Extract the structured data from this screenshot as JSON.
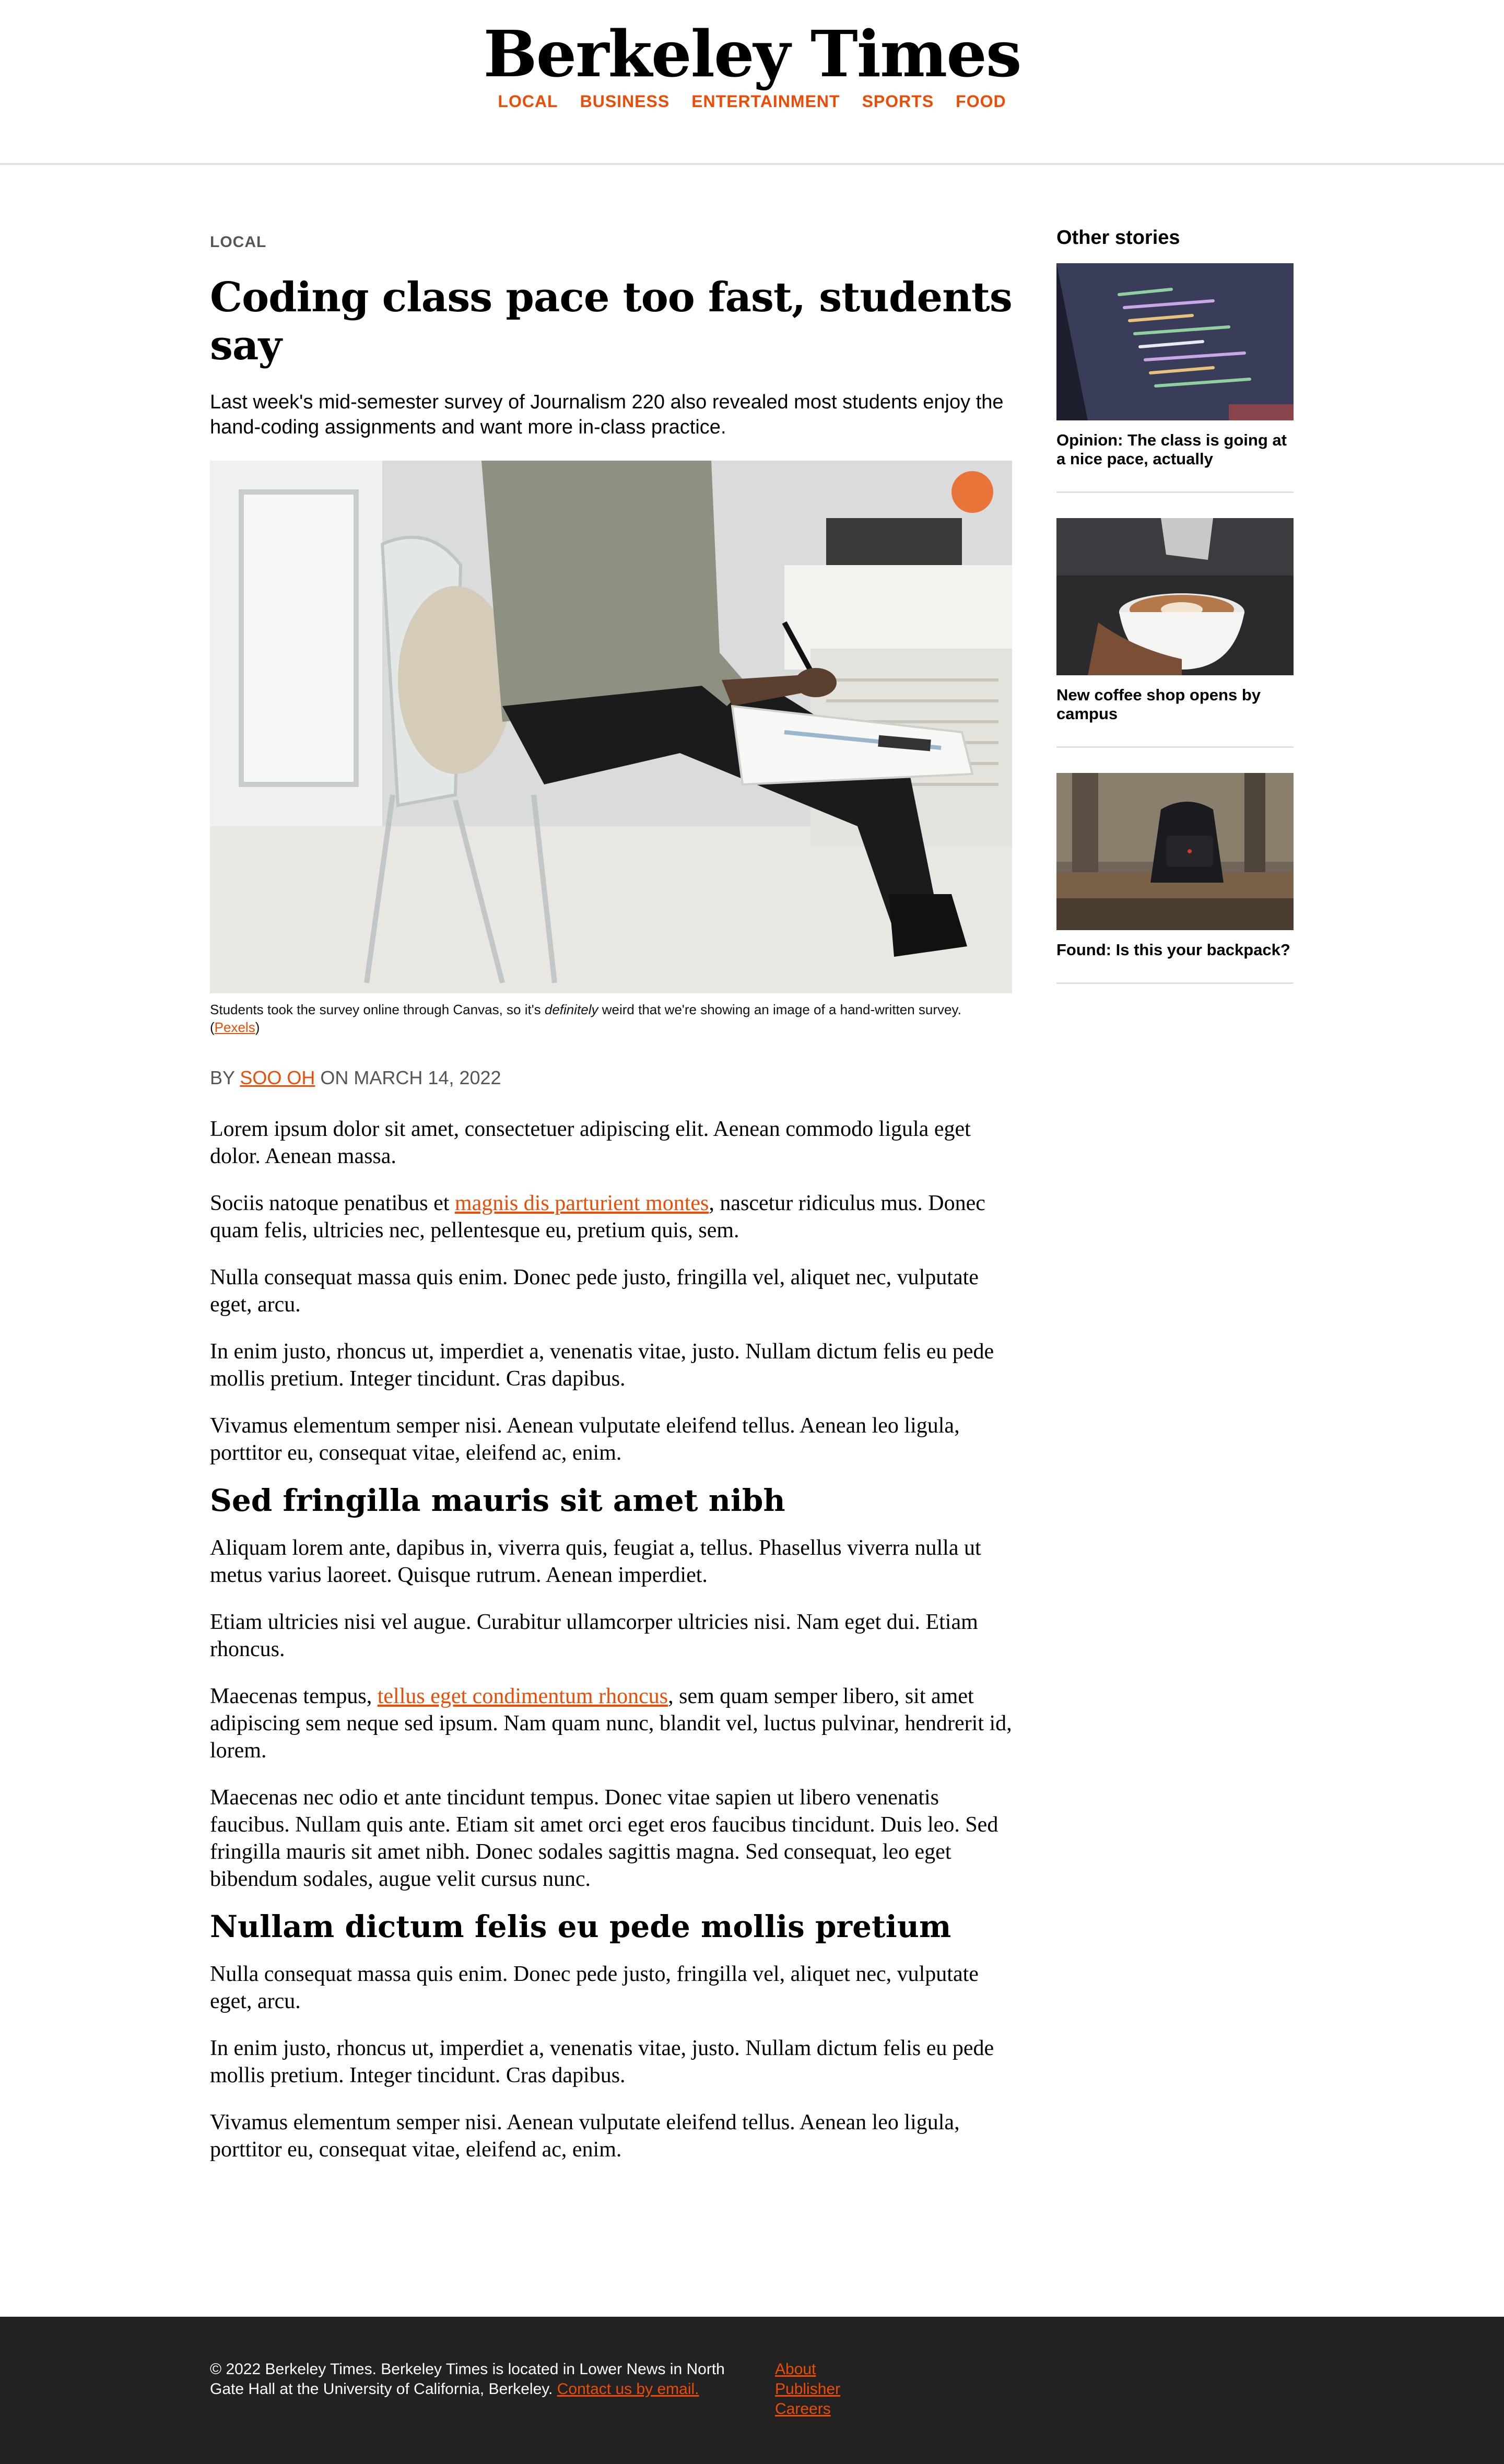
{
  "header": {
    "masthead": "Berkeley Times",
    "nav": [
      "LOCAL",
      "BUSINESS",
      "ENTERTAINMENT",
      "SPORTS",
      "FOOD"
    ]
  },
  "article": {
    "kicker": "LOCAL",
    "headline": "Coding class pace too fast, students say",
    "dek": "Last week's mid-semester survey of Journalism 220 also revealed most students enjoy the hand-coding assignments and want more in-class practice.",
    "caption": {
      "before": "Students took the survey online through Canvas, so it's ",
      "emphasis": "definitely",
      "after": " weird that we're showing an image of a hand-written survey. (",
      "link": "Pexels",
      "close": ")"
    },
    "byline": {
      "by": "BY ",
      "author": "SOO OH",
      "date": " ON MARCH 14, 2022"
    },
    "p1": "Lorem ipsum dolor sit amet, consectetuer adipiscing elit. Aenean commodo ligula eget dolor. Aenean massa.",
    "p2": {
      "before": "Sociis natoque penatibus et ",
      "link": "magnis dis parturient montes",
      "after": ", nascetur ridiculus mus. Donec quam felis, ultricies nec, pellentesque eu, pretium quis, sem."
    },
    "p3": "Nulla consequat massa quis enim. Donec pede justo, fringilla vel, aliquet nec, vulputate eget, arcu.",
    "p4": "In enim justo, rhoncus ut, imperdiet a, venenatis vitae, justo. Nullam dictum felis eu pede mollis pretium. Integer tincidunt. Cras dapibus.",
    "p5": "Vivamus elementum semper nisi. Aenean vulputate eleifend tellus. Aenean leo ligula, porttitor eu, consequat vitae, eleifend ac, enim.",
    "subhead1": "Sed fringilla mauris sit amet nibh",
    "p6": "Aliquam lorem ante, dapibus in, viverra quis, feugiat a, tellus. Phasellus viverra nulla ut metus varius laoreet. Quisque rutrum. Aenean imperdiet.",
    "p7": "Etiam ultricies nisi vel augue. Curabitur ullamcorper ultricies nisi. Nam eget dui. Etiam rhoncus.",
    "p8": {
      "before": "Maecenas tempus, ",
      "link": "tellus eget condimentum rhoncus",
      "after": ", sem quam semper libero, sit amet adipiscing sem neque sed ipsum. Nam quam nunc, blandit vel, luctus pulvinar, hendrerit id, lorem."
    },
    "p9": "Maecenas nec odio et ante tincidunt tempus. Donec vitae sapien ut libero venenatis faucibus. Nullam quis ante. Etiam sit amet orci eget eros faucibus tincidunt. Duis leo. Sed fringilla mauris sit amet nibh. Donec sodales sagittis magna. Sed consequat, leo eget bibendum sodales, augue velit cursus nunc.",
    "subhead2": "Nullam dictum felis eu pede mollis pretium",
    "p10": "Nulla consequat massa quis enim. Donec pede justo, fringilla vel, aliquet nec, vulputate eget, arcu.",
    "p11": "In enim justo, rhoncus ut, imperdiet a, venenatis vitae, justo. Nullam dictum felis eu pede mollis pretium. Integer tincidunt. Cras dapibus.",
    "p12": "Vivamus elementum semper nisi. Aenean vulputate eleifend tellus. Aenean leo ligula, porttitor eu, consequat vitae, eleifend ac, enim."
  },
  "sidebar": {
    "title": "Other stories",
    "stories": [
      {
        "title": "Opinion: The class is going at a nice pace, actually"
      },
      {
        "title": "New coffee shop opens by campus"
      },
      {
        "title": "Found: Is this your backpack?"
      }
    ]
  },
  "footer": {
    "text": "© 2022 Berkeley Times. Berkeley Times is located in Lower News in North Gate Hall at the University of California, Berkeley. ",
    "contact_link": "Contact us by email.",
    "links": [
      "About",
      "Publisher",
      "Careers"
    ]
  },
  "colors": {
    "accent": "#ee4c05",
    "footer_bg": "#222222",
    "kicker": "#555555"
  }
}
